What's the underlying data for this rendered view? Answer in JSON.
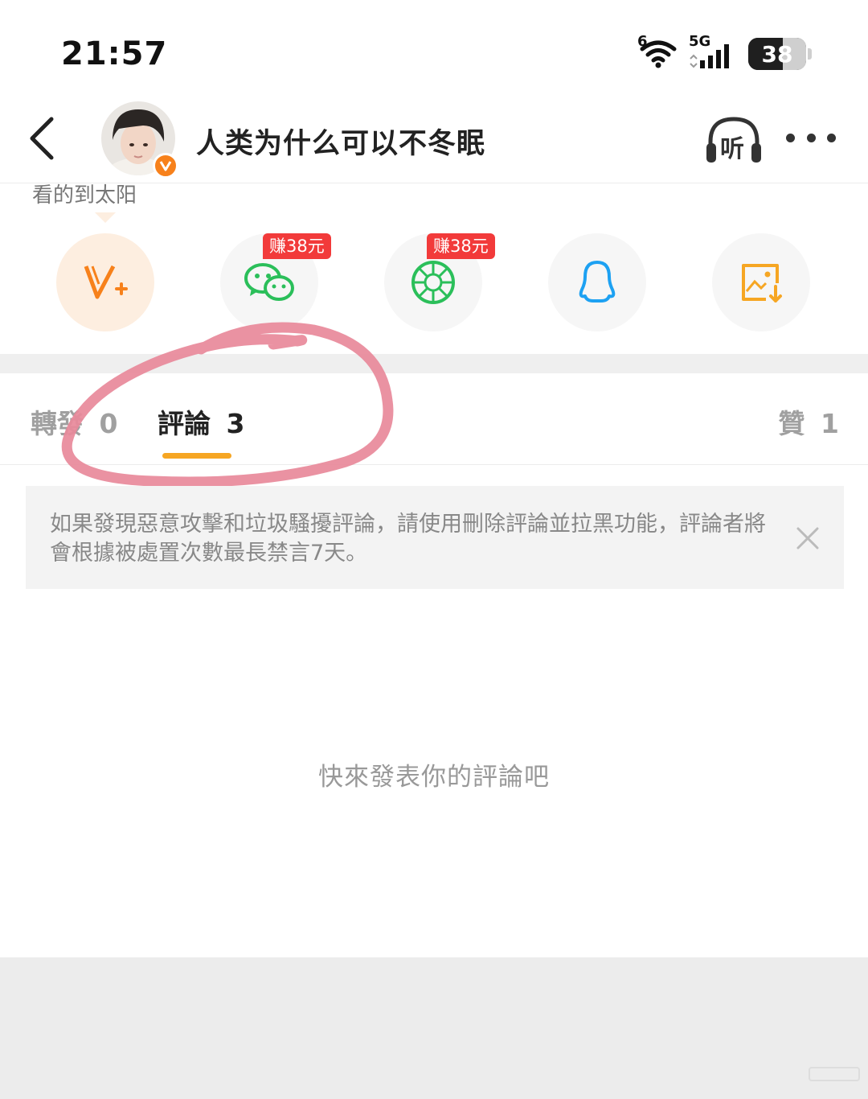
{
  "status_bar": {
    "time": "21:57",
    "wifi_badge": "6",
    "network": "5G",
    "battery": "38"
  },
  "header": {
    "back_icon": "chevron-left-icon",
    "title": "人类为什么可以不冬眠",
    "listen_label": "听",
    "more_icon": "more-dots-icon"
  },
  "tooltip": {
    "text": "看的到太阳"
  },
  "share": {
    "items": [
      {
        "icon": "vip-plus-icon",
        "color": "#f7811b"
      },
      {
        "icon": "wechat-icon",
        "color": "#2bbf5a",
        "badge": "赚38元"
      },
      {
        "icon": "moments-icon",
        "color": "#2bbf5a",
        "badge": "赚38元"
      },
      {
        "icon": "qq-icon",
        "color": "#1da1f2"
      },
      {
        "icon": "save-image-icon",
        "color": "#f6a623"
      }
    ]
  },
  "tabs": {
    "repost": {
      "label": "轉發",
      "count": "0"
    },
    "comment": {
      "label": "評論",
      "count": "3"
    },
    "like": {
      "label": "贊",
      "count": "1"
    },
    "accent": "#f6a623"
  },
  "notice": {
    "text": "如果發現惡意攻擊和垃圾騷擾評論，請使用刪除評論並拉黑功能，評論者將會根據被處置次數最長禁言7天。"
  },
  "empty_state": {
    "text": "快來發表你的評論吧"
  }
}
